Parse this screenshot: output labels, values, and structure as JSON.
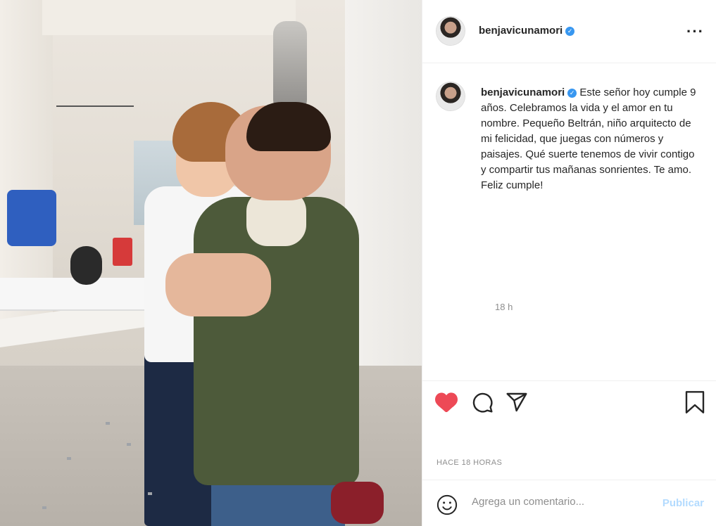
{
  "post": {
    "image_alt": "",
    "author": {
      "username": "benjavicunamori",
      "verified_icon": "verified-badge-icon"
    },
    "caption": {
      "username": "benjavicunamori",
      "text": "Este señor hoy cumple 9 años. Celebramos la vida y el amor en tu nombre. Pequeño Beltrán, niño arquitecto de mi felicidad, que juegas con números y paisajes. Qué suerte tenemos de vivir contigo y compartir tus mañanas sonrientes. Te amo. Feliz cumple!",
      "time": "18 h"
    },
    "actions": {
      "like_icon": "heart-filled-icon",
      "comment_icon": "comment-icon",
      "share_icon": "paper-plane-icon",
      "save_icon": "bookmark-icon",
      "liked": true
    },
    "timestamp": "HACE 18 HORAS",
    "comment_box": {
      "emoji_icon": "smiley-icon",
      "placeholder": "Agrega un comentario...",
      "publish_label": "Publicar"
    },
    "more_icon": "more-horizontal-icon"
  },
  "colors": {
    "like_red": "#ed4956",
    "verified_blue": "#3897f0",
    "publish_disabled": "#b3dbff",
    "muted_text": "#8e8e8e",
    "divider": "#efefef"
  }
}
